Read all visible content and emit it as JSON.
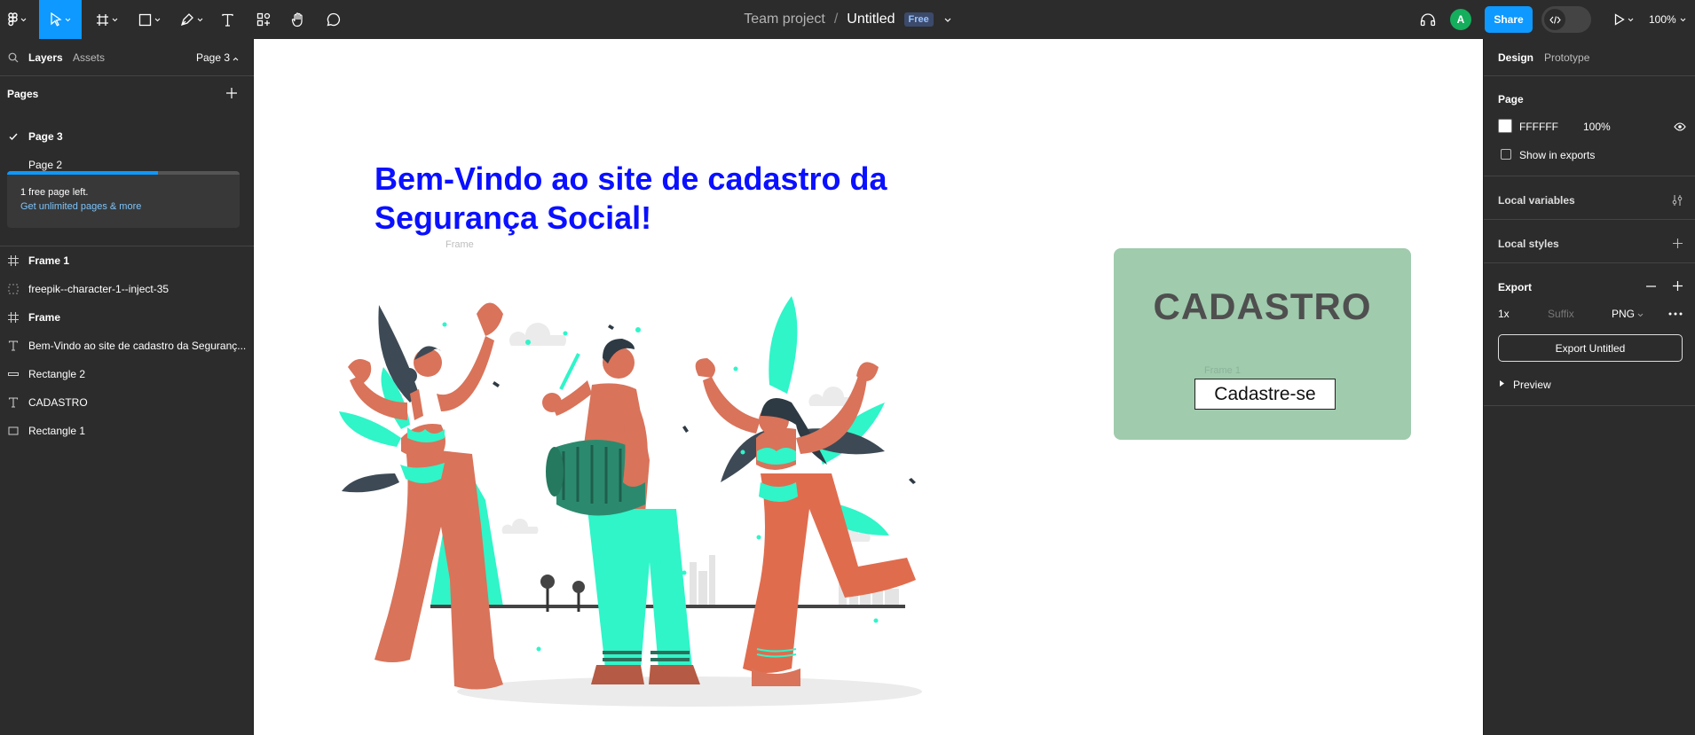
{
  "toolbar": {
    "tools": [
      "main-menu",
      "move-tool",
      "frame-tool",
      "shape-tool",
      "pen-tool",
      "text-tool",
      "resources-tool",
      "hand-tool",
      "comment-tool"
    ],
    "zoom": "100%",
    "share_label": "Share",
    "avatar_initial": "A"
  },
  "file": {
    "team": "Team project",
    "separator": "/",
    "name": "Untitled",
    "plan_badge": "Free"
  },
  "left_panel": {
    "tabs": {
      "layers": "Layers",
      "assets": "Assets"
    },
    "current_page": "Page 3",
    "pages_title": "Pages",
    "pages": [
      {
        "name": "Page 3",
        "selected": true
      },
      {
        "name": "Page 2",
        "selected": false
      }
    ],
    "upsell": {
      "line1": "1 free page left.",
      "line2": "Get unlimited pages & more",
      "progress_fraction": 0.65
    },
    "layers": [
      {
        "name": "Frame 1",
        "icon": "frame-icon",
        "bold": true
      },
      {
        "name": "freepik--character-1--inject-35",
        "icon": "group-icon",
        "bold": false
      },
      {
        "name": "Frame",
        "icon": "frame-icon",
        "bold": true
      },
      {
        "name": "Bem-Vindo ao site de cadastro da Seguranç...",
        "icon": "text-icon",
        "bold": false
      },
      {
        "name": "Rectangle 2",
        "icon": "line-icon",
        "bold": false
      },
      {
        "name": "CADASTRO",
        "icon": "text-icon",
        "bold": false
      },
      {
        "name": "Rectangle 1",
        "icon": "rectangle-icon",
        "bold": false
      }
    ]
  },
  "canvas": {
    "heading": "Bem-Vindo ao site de cadastro da Segurança Social!",
    "frame_label": "Frame",
    "frame1_label": "Frame 1",
    "card_title": "CADASTRO",
    "card_button": "Cadastre-se",
    "colors": {
      "heading": "#0a10ff",
      "card": "#a0cbad",
      "accent_teal": "#2ff5c9",
      "skin": "#d9735a"
    }
  },
  "right_panel": {
    "tabs": {
      "design": "Design",
      "prototype": "Prototype"
    },
    "page_section": "Page",
    "page_color": "FFFFFF",
    "page_opacity": "100%",
    "show_in_exports": "Show in exports",
    "local_variables": "Local variables",
    "local_styles": "Local styles",
    "export_title": "Export",
    "export_scale": "1x",
    "export_suffix_placeholder": "Suffix",
    "export_format": "PNG",
    "export_button": "Export Untitled",
    "preview": "Preview"
  }
}
